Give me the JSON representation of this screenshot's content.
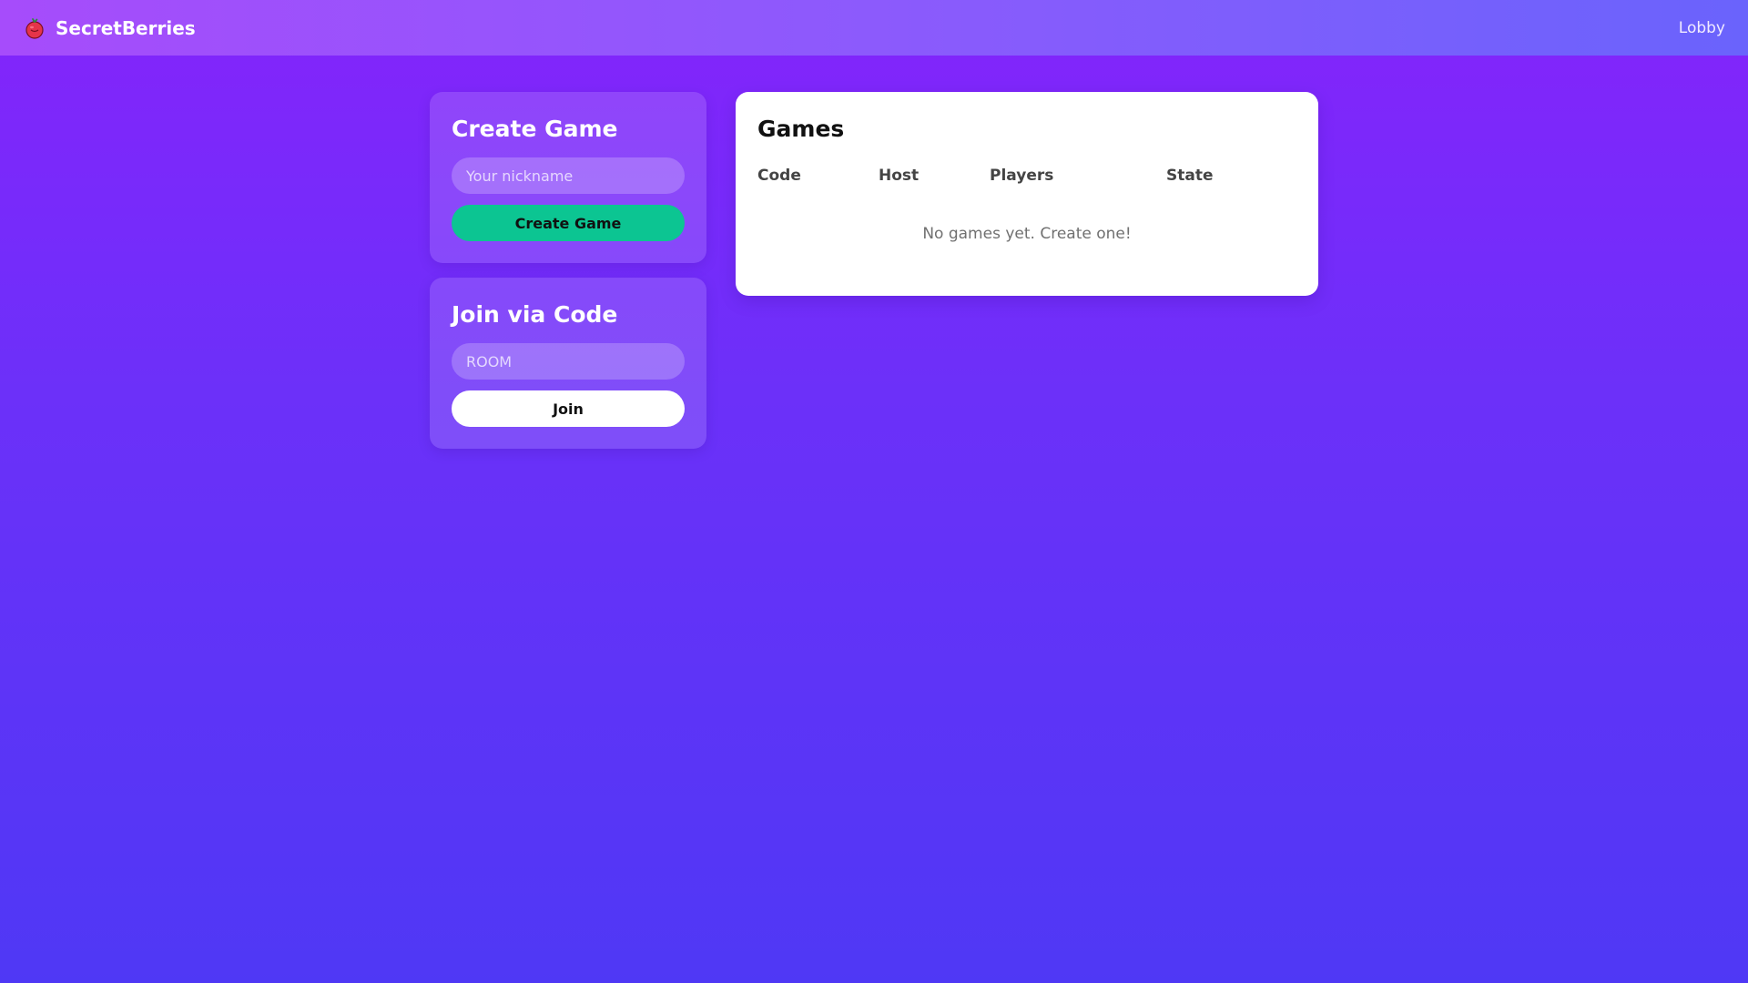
{
  "header": {
    "brand": "SecretBerries",
    "brand_icon": "berry-icon",
    "nav_link": "Lobby"
  },
  "create_game": {
    "title": "Create Game",
    "nickname_placeholder": "Your nickname",
    "nickname_value": "",
    "button_label": "Create Game"
  },
  "join": {
    "title": "Join via Code",
    "code_placeholder": "ROOM",
    "code_value": "",
    "button_label": "Join"
  },
  "games": {
    "title": "Games",
    "columns": [
      "Code",
      "Host",
      "Players",
      "State"
    ],
    "rows": [],
    "empty_message": "No games yet. Create one!"
  },
  "colors": {
    "accent_green": "#0cc592",
    "background_top": "#8424fb",
    "background_bottom": "#4f38f5"
  }
}
